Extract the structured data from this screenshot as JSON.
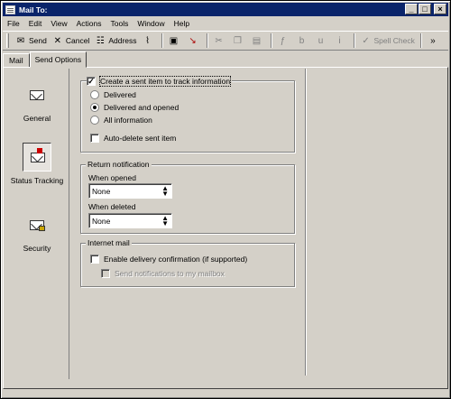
{
  "window": {
    "title": "Mail To:"
  },
  "menu": [
    "File",
    "Edit",
    "View",
    "Actions",
    "Tools",
    "Window",
    "Help"
  ],
  "toolbar": {
    "send": "Send",
    "cancel": "Cancel",
    "address": "Address",
    "spell_check": "Spell Check"
  },
  "tabs": [
    "Mail",
    "Send Options"
  ],
  "categories": [
    {
      "label": "General"
    },
    {
      "label": "Status Tracking"
    },
    {
      "label": "Security"
    }
  ],
  "tracking": {
    "create_label": "Create a sent item to track information",
    "create_checked": true,
    "options": [
      "Delivered",
      "Delivered and opened",
      "All information"
    ],
    "selected": "Delivered and opened",
    "auto_delete": "Auto-delete sent item",
    "auto_delete_checked": false
  },
  "return_notification": {
    "title": "Return notification",
    "when_opened_label": "When opened",
    "when_opened_value": "None",
    "when_deleted_label": "When deleted",
    "when_deleted_value": "None"
  },
  "internet_mail": {
    "title": "Internet mail",
    "enable_label": "Enable delivery confirmation (if supported)",
    "enable_checked": false,
    "send_notifications_label": "Send notifications to my mailbox"
  }
}
